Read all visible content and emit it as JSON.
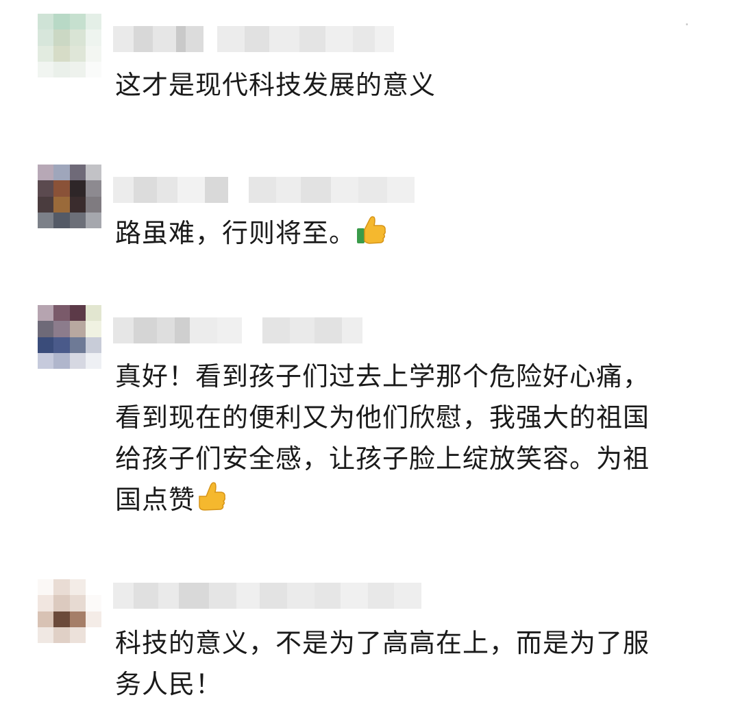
{
  "comments": [
    {
      "text": "这才是现代科技发展的意义",
      "emoji": ""
    },
    {
      "text": "路虽难，行则将至。",
      "emoji": "thumbs-up-icon"
    },
    {
      "text": "真好！看到孩子们过去上学那个危险好心痛，\n看到现在的便利又为他们欣慰，我强大的祖国\n给孩子们安全感，让孩子脸上绽放笑容。为祖\n国点赞",
      "emoji": "thumbs-up-icon"
    },
    {
      "text": "科技的意义，不是为了高高在上，而是为了服\n务人民！",
      "emoji": ""
    }
  ],
  "colors": {
    "text": "#1a1a1a",
    "thumb": "#f5b82e",
    "cuff": "#3a9b4a"
  }
}
